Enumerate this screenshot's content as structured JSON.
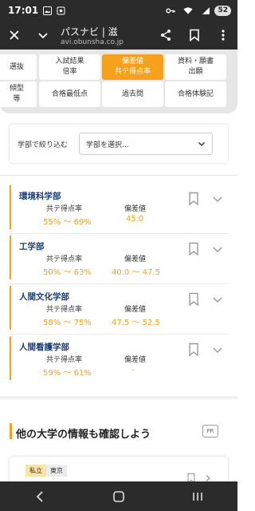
{
  "status_bar": {
    "time": "17:01",
    "battery": "52"
  },
  "browser": {
    "title": "パスナビ | 滋",
    "url": "avi.obunsha.co.jp"
  },
  "tabs": [
    {
      "label": "選抜",
      "active": false
    },
    {
      "label": "入試結果\n倍率",
      "active": false
    },
    {
      "label": "偏差値\n共テ得点率",
      "active": true
    },
    {
      "label": "資料・願書\n出願",
      "active": false
    },
    {
      "label": "傾型\n等",
      "active": false
    },
    {
      "label": "合格最低点",
      "active": false
    },
    {
      "label": "過去問",
      "active": false
    },
    {
      "label": "合格体験記",
      "active": false
    }
  ],
  "filter": {
    "label": "学部で絞り込む",
    "placeholder": "学部を選択..."
  },
  "faculties": [
    {
      "name": "環境科学部",
      "score_label": "共テ得点率",
      "score_value": "55% 〜 69%",
      "deviation_label": "偏差値",
      "deviation_value": "45.0"
    },
    {
      "name": "工学部",
      "score_label": "共テ得点率",
      "score_value": "50% 〜 63%",
      "deviation_label": "偏差値",
      "deviation_value": "40.0 〜 47.5"
    },
    {
      "name": "人間文化学部",
      "score_label": "共テ得点率",
      "score_value": "58% 〜 75%",
      "deviation_label": "偏差値",
      "deviation_value": "47.5 〜 52.5"
    },
    {
      "name": "人間看護学部",
      "score_label": "共テ得点率",
      "score_value": "59% 〜 61%",
      "deviation_label": "偏差値",
      "deviation_value": "-"
    }
  ],
  "other_section": {
    "title": "他の大学の情報も確認しよう",
    "pr": "PR",
    "card": {
      "type": "私立",
      "location": "東京"
    }
  },
  "colors": {
    "accent": "#f5a11e",
    "navy": "#1a3c7a",
    "dark_bar": "#2b2b2b"
  }
}
